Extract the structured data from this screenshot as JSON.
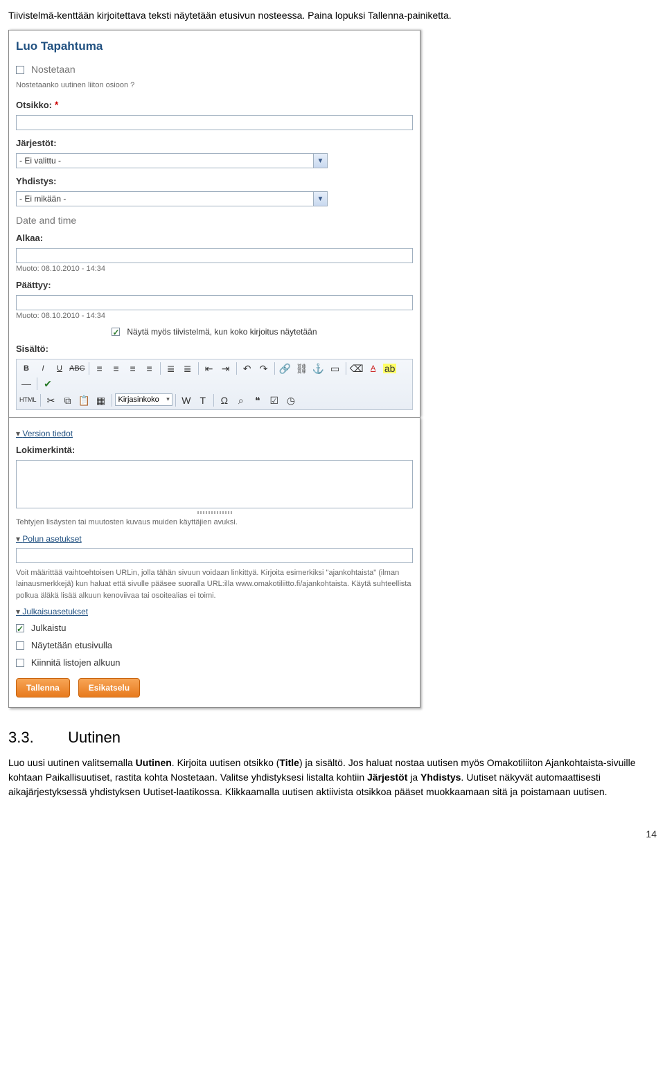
{
  "pageNumber": "14",
  "intro": "Tiivistelmä-kenttään kirjoitettava teksti näytetään etusivun nosteessa. Paina lopuksi Tallenna-painiketta.",
  "panel": {
    "title": "Luo Tapahtuma",
    "nostetaan": {
      "label": "Nostetaan",
      "hint": "Nostetaanko uutinen liiton osioon ?"
    },
    "otsikko": {
      "label": "Otsikko:"
    },
    "jarjestot": {
      "label": "Järjestöt:",
      "value": "- Ei valittu -"
    },
    "yhdistys": {
      "label": "Yhdistys:",
      "value": "- Ei mikään -"
    },
    "datetime": "Date and time",
    "alkaa": {
      "label": "Alkaa:",
      "muoto": "Muoto: 08.10.2010 - 14:34"
    },
    "paattyy": {
      "label": "Päättyy:",
      "muoto": "Muoto: 08.10.2010 - 14:34"
    },
    "tiivistelma_chk": "Näytä myös tiivistelmä, kun koko kirjoitus näytetään",
    "sisalto": "Sisältö:",
    "toolbar": {
      "B": "B",
      "I": "I",
      "U": "U",
      "ABC": "ABC",
      "HTML": "HTML",
      "size": "Kirjasinkoko"
    },
    "version": "Version tiedot",
    "loki": {
      "label": "Lokimerkintä:",
      "hint": "Tehtyjen lisäysten tai muutosten kuvaus muiden käyttäjien avuksi."
    },
    "polku": {
      "title": "Polun asetukset",
      "hint": "Voit määrittää vaihtoehtoisen URLin, jolla tähän sivuun voidaan linkittyä. Kirjoita esimerkiksi \"ajankohtaista\" (ilman lainausmerkkejä) kun haluat että sivulle pääsee suoralla URL:illa www.omakotiliitto.fi/ajankohtaista. Käytä suhteellista polkua äläkä lisää alkuun kenoviivaa tai osoitealias ei toimi."
    },
    "julkaisu": {
      "title": "Julkaisuasetukset",
      "julkaistu": "Julkaistu",
      "etusivu": "Näytetään etusivulla",
      "kiinnita": "Kiinnitä listojen alkuun"
    },
    "buttons": {
      "save": "Tallenna",
      "preview": "Esikatselu"
    }
  },
  "section": {
    "number": "3.3.",
    "title": "Uutinen",
    "p1a": "Luo uusi uutinen valitsemalla ",
    "p1b": "Uutinen",
    "p1c": "Kirjoita uutisen otsikko (",
    "p1d": "Title",
    "p1e": "Jos haluat nostaa uutisen myös Omakotiliiton Ajankohtaista-sivuille kohtaan Paikallisuutiset, rastita kohta Nostetaan. Valitse yhdistyksesi listalta kohtiin ",
    "p1f": "Järjestöt",
    "p1g": " ja ",
    "p1h": "Yhdistys",
    "p1i": "Uutiset näkyvät automaattisesti aikajärjestyksessä yhdistyksen Uutiset-laatikossa. Klikkaamalla uutisen aktiivista otsikkoa pääset muokkaamaan sitä ja poistamaan uutisen."
  }
}
